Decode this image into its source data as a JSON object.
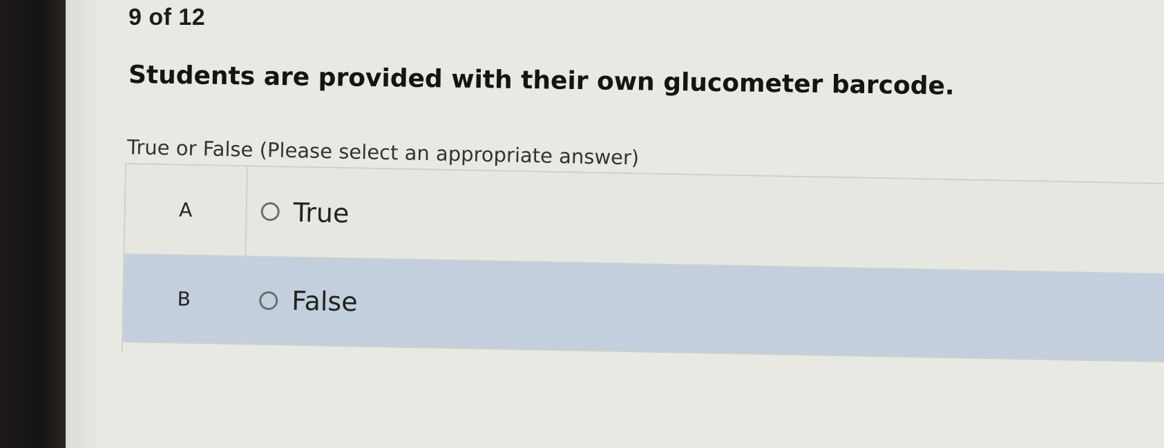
{
  "header": {
    "progress": "9 of 12"
  },
  "question": {
    "text": "Students are provided with their own glucometer barcode.",
    "instruction": "True or False (Please select an appropriate answer)"
  },
  "options": [
    {
      "letter": "A",
      "label": "True",
      "selected": false
    },
    {
      "letter": "B",
      "label": "False",
      "selected": false
    }
  ],
  "colors": {
    "page_background": "#e8e9e3",
    "highlight_row": "#c3cfdd",
    "border": "#cfd0ca",
    "text": "#1c1c1c"
  }
}
